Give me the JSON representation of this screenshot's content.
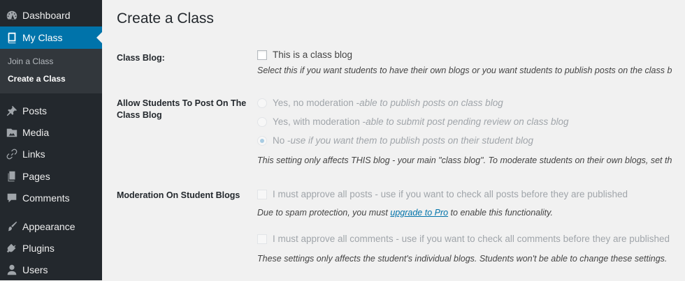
{
  "sidebar": {
    "items": [
      {
        "label": "Dashboard",
        "icon": "dashboard-icon"
      },
      {
        "label": "My Class",
        "icon": "book-icon",
        "current": true
      },
      {
        "label": "Posts",
        "icon": "pin-icon"
      },
      {
        "label": "Media",
        "icon": "media-icon"
      },
      {
        "label": "Links",
        "icon": "link-icon"
      },
      {
        "label": "Pages",
        "icon": "pages-icon"
      },
      {
        "label": "Comments",
        "icon": "comment-icon"
      },
      {
        "label": "Appearance",
        "icon": "brush-icon"
      },
      {
        "label": "Plugins",
        "icon": "plugin-icon"
      },
      {
        "label": "Users",
        "icon": "user-icon"
      }
    ],
    "submenu": [
      {
        "label": "Join a Class"
      },
      {
        "label": "Create a Class",
        "current": true
      }
    ]
  },
  "page": {
    "title": "Create a Class",
    "class_blog": {
      "label": "Class Blog:",
      "checkbox_label": "This is a class blog",
      "description": "Select this if you want students to have their own blogs or you want students to publish posts on the class b"
    },
    "allow_post": {
      "label": "Allow Students To Post On The Class Blog",
      "options": [
        {
          "text": "Yes, no moderation - ",
          "em": "able to publish posts on class blog"
        },
        {
          "text": "Yes, with moderation - ",
          "em": "able to submit post pending review on class blog"
        },
        {
          "text": "No - ",
          "em": "use if you want them to publish posts on their student blog",
          "checked": true
        }
      ],
      "description": "This setting only affects THIS blog - your main \"class blog\". To moderate students on their own blogs, set th"
    },
    "moderation": {
      "label": "Moderation On Student Blogs",
      "posts_checkbox": "I must approve all posts - use if you want to check all posts before they are published",
      "spam_prefix": "Due to spam protection, you must ",
      "spam_link": "upgrade to Pro",
      "spam_suffix": " to enable this functionality.",
      "comments_checkbox": "I must approve all comments - use if you want to check all comments before they are published",
      "footer_description": "These settings only affects the student's individual blogs. Students won't be able to change these settings."
    }
  },
  "colors": {
    "sidebar_bg": "#23282d",
    "accent": "#0073aa",
    "page_bg": "#f1f1f1"
  }
}
